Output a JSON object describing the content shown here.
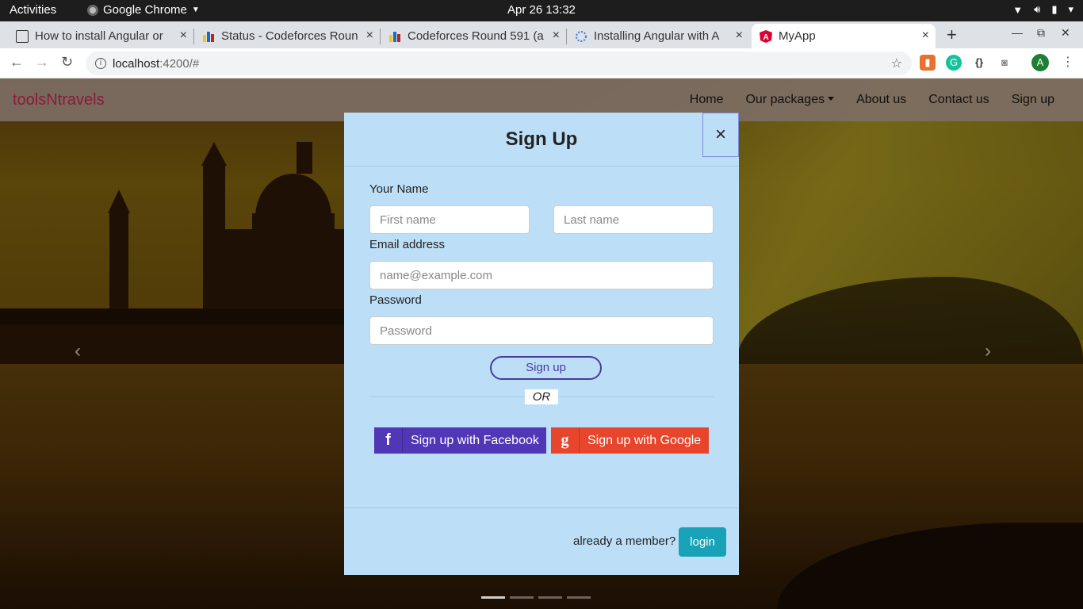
{
  "system": {
    "activities": "Activities",
    "app_name": "Google Chrome",
    "clock": "Apr 26  13:32"
  },
  "tabs": [
    {
      "title": "How to install Angular or",
      "icon": "terminal-icon"
    },
    {
      "title": "Status - Codeforces Roun",
      "icon": "codeforces-icon"
    },
    {
      "title": "Codeforces Round 591 (a",
      "icon": "codeforces-icon"
    },
    {
      "title": "Installing Angular with A",
      "icon": "site-icon"
    },
    {
      "title": "MyApp",
      "icon": "angular-icon",
      "active": true
    }
  ],
  "address": {
    "host": "localhost",
    "path": ":4200/#"
  },
  "profile_initial": "A",
  "navbar": {
    "brand": "toolsNtravels",
    "links": [
      "Home",
      "Our packages",
      "About us",
      "Contact us",
      "Sign up"
    ]
  },
  "modal": {
    "title": "Sign Up",
    "close": "×",
    "name_label": "Your Name",
    "first_name_placeholder": "First name",
    "last_name_placeholder": "Last name",
    "email_label": "Email address",
    "email_placeholder": "name@example.com",
    "password_label": "Password",
    "password_placeholder": "Password",
    "signup_button": "Sign up",
    "or": "OR",
    "facebook_button": "Sign up with Facebook",
    "facebook_icon": "f",
    "google_button": "Sign up with Google",
    "google_icon": "g",
    "member_question": "already a member?",
    "login_button": "login"
  },
  "colors": {
    "brand": "#8b1a3a",
    "modal_bg": "#bcdff7",
    "facebook": "#5136b6",
    "google": "#e8462c",
    "login": "#17a2b8"
  }
}
